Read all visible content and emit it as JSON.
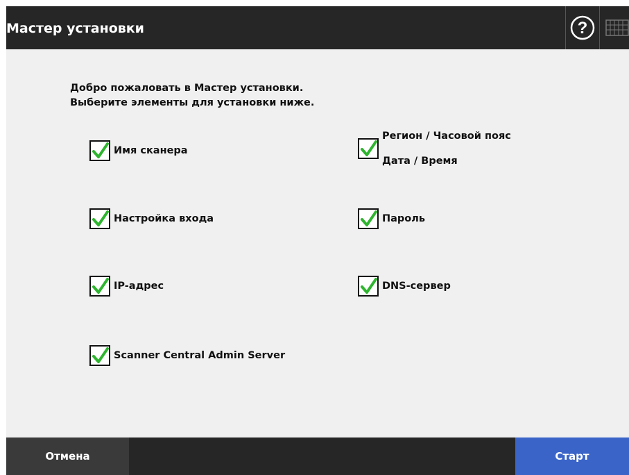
{
  "header": {
    "title": "Мастер установки",
    "help_icon": "question-circle-icon",
    "keyboard_icon": "keyboard-icon"
  },
  "intro": {
    "line1": "Добро пожаловать в Мастер установки.",
    "line2": "Выберите элементы для установки ниже."
  },
  "options": [
    {
      "label": "Имя сканера",
      "checked": true
    },
    {
      "label": "Регион / Часовой пояс",
      "label2": "Дата / Время",
      "checked": true
    },
    {
      "label": "Настройка входа",
      "checked": true
    },
    {
      "label": "Пароль",
      "checked": true
    },
    {
      "label": "IP-адрес",
      "checked": true
    },
    {
      "label": "DNS-сервер",
      "checked": true
    },
    {
      "label": "Scanner Central Admin Server",
      "checked": true
    }
  ],
  "footer": {
    "cancel_label": "Отмена",
    "start_label": "Старт"
  },
  "colors": {
    "header_bg": "#262626",
    "content_bg": "#f0f0f0",
    "start_button": "#3a64c8",
    "check_mark": "#2fb52f"
  }
}
